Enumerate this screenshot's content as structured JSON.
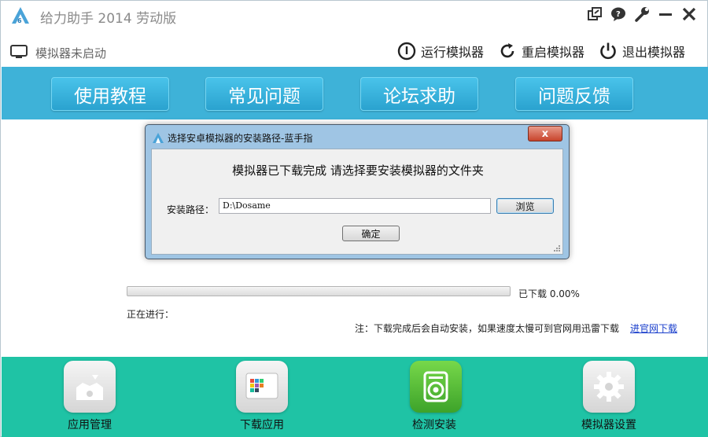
{
  "app": {
    "title": "给力助手 2014 劳动版"
  },
  "title_icons": [
    "restore-icon",
    "chat-icon",
    "wrench-icon",
    "minimize-icon",
    "close-icon"
  ],
  "status": {
    "emulator_status": "模拟器未启动",
    "run_label": "运行模拟器",
    "restart_label": "重启模拟器",
    "exit_label": "退出模拟器"
  },
  "nav": [
    "使用教程",
    "常见问题",
    "论坛求助",
    "问题反馈"
  ],
  "download": {
    "progress_percent": 0,
    "progress_text": "已下载 0.00%",
    "in_progress": "正在进行：",
    "note": "注：下载完成后会自动安装，如果速度太慢可到官网用迅雷下载",
    "official_link": "进官网下载"
  },
  "bottom": {
    "tiles": [
      {
        "label": "应用管理",
        "icon": "app-manage-icon"
      },
      {
        "label": "下载应用",
        "icon": "download-app-icon"
      },
      {
        "label": "检测安装",
        "icon": "detect-install-icon"
      },
      {
        "label": "模拟器设置",
        "icon": "settings-icon"
      }
    ]
  },
  "dialog": {
    "title": "选择安卓模拟器的安装路径-蓝手指",
    "close_glyph": "x",
    "message": "模拟器已下载完成 请选择要安装模拟器的文件夹",
    "path_label": "安装路径：",
    "path_value": "D:\\Dosame",
    "browse_label": "浏览",
    "ok_label": "确定"
  },
  "colors": {
    "nav_band": "#3eb2d8",
    "bottom_panel": "#1fc3a5",
    "link": "#1a3fcc"
  }
}
